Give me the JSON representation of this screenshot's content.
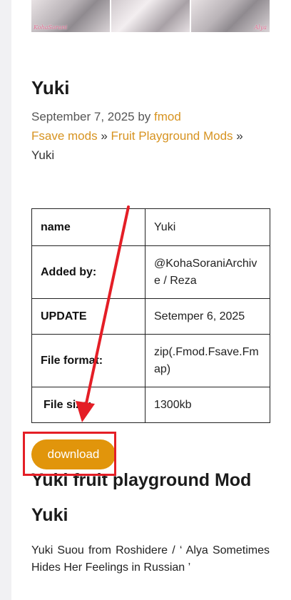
{
  "banner": {
    "watermark_left": "KohaSorani",
    "watermark_right": "Alya"
  },
  "post": {
    "title": "Yuki",
    "date": "September 7, 2025",
    "by": "by",
    "author": "fmod",
    "breadcrumbs": [
      "Fsave mods",
      "Fruit Playground Mods",
      "Yuki"
    ],
    "separator": "»"
  },
  "info_table": {
    "rows": [
      {
        "key": "name",
        "value": "Yuki"
      },
      {
        "key": "Added by:",
        "value": "@KohaSoraniArchive / Reza"
      },
      {
        "key": "UPDATE",
        "value": "Setemper 6, 2025"
      },
      {
        "key": "File format:",
        "value": "zip(.Fmod.Fsave.Fmap)"
      },
      {
        "key": "File size:",
        "value": "1300kb"
      }
    ]
  },
  "download": {
    "label": "download"
  },
  "section": {
    "heading_1": "Yuki fruit playground Mod",
    "heading_2": "Yuki",
    "description": "Yuki Suou from Roshidere / ‘ Alya Sometimes Hides Her Feelings in Russian ’"
  },
  "annotation": {
    "color": "#e41e26"
  }
}
